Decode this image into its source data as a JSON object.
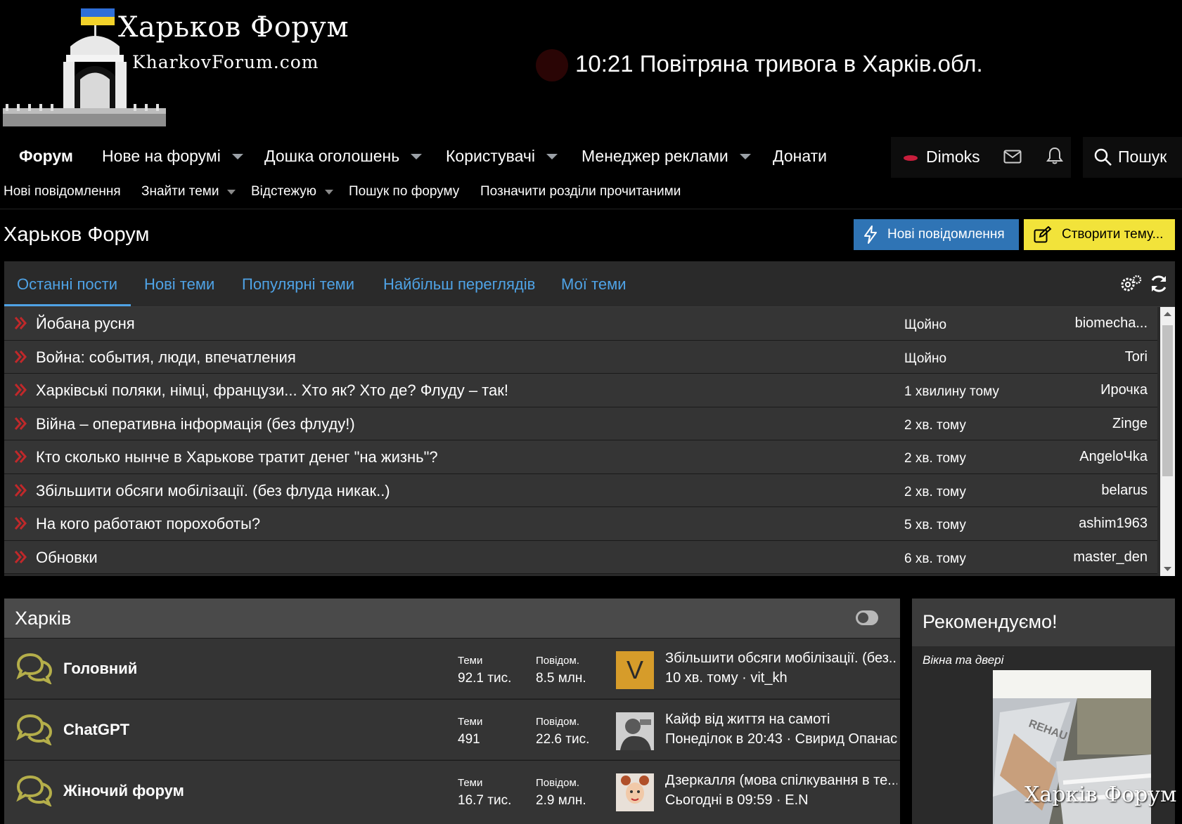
{
  "header": {
    "logo_title": "Харьков Форум",
    "logo_sub": "KharkovForum.com",
    "alert_text": "10:21 Повітряна тривога в Харків.обл."
  },
  "nav": {
    "items": [
      {
        "label": "Форум",
        "has_menu": false
      },
      {
        "label": "Нове на форумі",
        "has_menu": true
      },
      {
        "label": "Дошка оголошень",
        "has_menu": true
      },
      {
        "label": "Користувачі",
        "has_menu": true
      },
      {
        "label": "Менеджер реклами",
        "has_menu": true
      },
      {
        "label": "Донати",
        "has_menu": false
      }
    ],
    "user": "Dimoks",
    "search": "Пошук"
  },
  "subnav": {
    "items": [
      {
        "label": "Нові повідомлення"
      },
      {
        "label": "Знайти теми"
      },
      {
        "label": "Відстежую"
      },
      {
        "label": "Пошук по форуму"
      },
      {
        "label": "Позначити розділи прочитаними"
      }
    ]
  },
  "page": {
    "title": "Харьков Форум",
    "btn_new": "Нові повідомлення",
    "btn_create": "Створити тему..."
  },
  "widget": {
    "tabs": [
      {
        "label": "Останні пости"
      },
      {
        "label": "Нові теми"
      },
      {
        "label": "Популярні теми"
      },
      {
        "label": "Найбільш переглядів"
      },
      {
        "label": "Мої теми"
      }
    ],
    "rows": [
      {
        "title": "Йобана русня",
        "time": "Щойно",
        "user": "biomecha..."
      },
      {
        "title": "Война: события, люди, впечатления",
        "time": "Щойно",
        "user": "Tori"
      },
      {
        "title": "Харківські поляки, німці, французи... Хто як? Хто де? Флуду – так!",
        "time": "1 хвилину тому",
        "user": "Ирочка"
      },
      {
        "title": "Війна – оперативна інформація (без флуду!)",
        "time": "2 хв. тому",
        "user": "Zinge"
      },
      {
        "title": "Кто сколько нынче в Харькове тратит денег \"на жизнь\"?",
        "time": "2 хв. тому",
        "user": "AngeloЧka"
      },
      {
        "title": "Збільшити обсяги мобілізації. (без флуда никак..)",
        "time": "2 хв. тому",
        "user": "belarus"
      },
      {
        "title": "На кого работают порохоботы?",
        "time": "5 хв. тому",
        "user": "ashim1963"
      },
      {
        "title": "Обновки",
        "time": "6 хв. тому",
        "user": "master_den"
      }
    ]
  },
  "category": {
    "title": "Харків",
    "forums": [
      {
        "name": "Головний",
        "topics_label": "Теми",
        "topics": "92.1 тис.",
        "posts_label": "Повідом.",
        "posts": "8.5 млн.",
        "avatar_letter": "V",
        "last_title": "Збільшити обсяги мобілізації. (без...",
        "last_meta": "10 хв. тому · vit_kh"
      },
      {
        "name": "ChatGPT",
        "topics_label": "Теми",
        "topics": "491",
        "posts_label": "Повідом.",
        "posts": "22.6 тис.",
        "avatar_letter": "",
        "last_title": "Кайф від життя на самоті",
        "last_meta": "Понеділок в 20:43 · Свирид Опанас"
      },
      {
        "name": "Жіночий форум",
        "topics_label": "Теми",
        "topics": "16.7 тис.",
        "posts_label": "Повідом.",
        "posts": "2.9 млн.",
        "avatar_letter": "",
        "last_title": "Дзеркалля (мова спілкування в те...",
        "last_meta": "Сьогодні в 09:59 · E.N"
      }
    ]
  },
  "sidebar": {
    "title": "Рекомендуємо!",
    "subtitle": "Вікна та двері",
    "image_brand": "REHAU",
    "watermark": "Харків Форум"
  },
  "colors": {
    "accent_blue": "#2f74b5",
    "accent_yellow": "#f2e33a",
    "tab_blue": "#4fa3e6",
    "arrow_red": "#c0282a",
    "forum_icon": "#b4ae4a"
  }
}
